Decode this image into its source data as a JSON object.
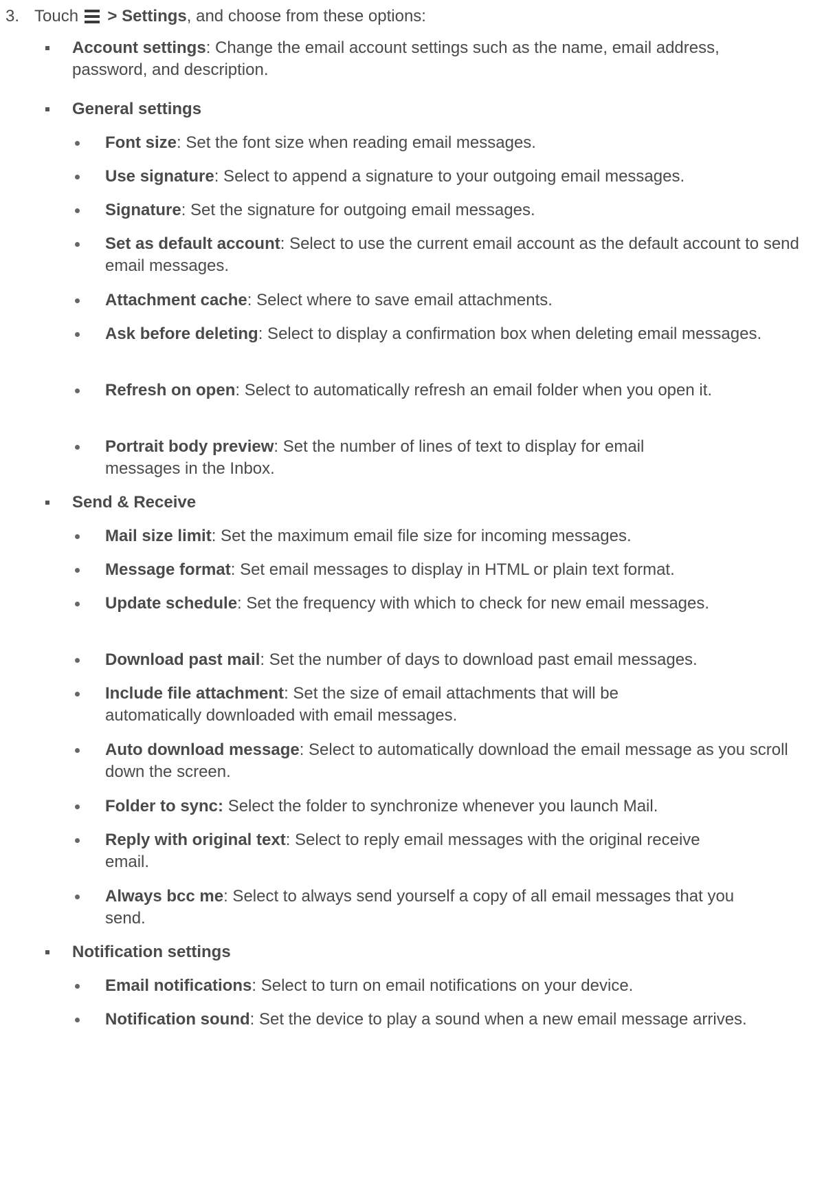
{
  "step": {
    "number": "3.",
    "before": "Touch",
    "menu_icon": "menu-icon",
    "gt": " >",
    "settings": "Settings",
    "after": ", and choose from these options:"
  },
  "account": {
    "title": "Account settings",
    "desc": ": Change the email account settings such as the name, email address, password, and description."
  },
  "general": {
    "title": "General settings",
    "items": [
      {
        "title": "Font size",
        "desc": ": Set the font size when reading email messages."
      },
      {
        "title": "Use signature",
        "desc": ": Select to append a signature to your outgoing email messages."
      },
      {
        "title": "Signature",
        "desc": ": Set the signature for outgoing email messages."
      },
      {
        "title": "Set as default account",
        "desc": ": Select to use the current email account as the default account to send email messages."
      },
      {
        "title": "Attachment cache",
        "desc": ": Select where to save email attachments."
      },
      {
        "title": "Ask before deleting",
        "desc": ": Select to display a confirmation box when deleting email messages."
      },
      {
        "title": "Refresh on open",
        "desc": ": Select to automatically refresh an email folder when you open it."
      },
      {
        "title": "Portrait body preview",
        "desc": ": Set the number of lines of text to display for email messages in the Inbox."
      }
    ]
  },
  "send_receive": {
    "title": "Send & Receive",
    "items": [
      {
        "title": "Mail size limit",
        "desc": ": Set the maximum email file size for incoming messages."
      },
      {
        "title": "Message format",
        "desc": ": Set email messages to display in HTML or plain text format."
      },
      {
        "title": "Update schedule",
        "desc": ": Set the frequency with which to check for new email messages."
      },
      {
        "title": "Download past mail",
        "desc": ": Set the number of days to download past email messages."
      },
      {
        "title": "Include file attachment",
        "desc": ": Set the size of email attachments that will be automatically downloaded with email messages."
      },
      {
        "title": "Auto download message",
        "desc": ": Select to automatically download the email message as you scroll down the screen."
      },
      {
        "title": "Folder to sync:",
        "desc": " Select the folder to synchronize whenever you launch Mail."
      },
      {
        "title": "Reply with original text",
        "desc": ": Select to reply email messages with the original receive email."
      },
      {
        "title": "Always bcc me",
        "desc": ": Select to always send yourself a copy of all email messages that you send."
      }
    ]
  },
  "notification": {
    "title": "Notification settings",
    "items": [
      {
        "title": "Email notifications",
        "desc": ": Select to turn on email notifications on your device."
      },
      {
        "title": "Notification sound",
        "desc": ": Set the device to play a sound when a new email message arrives."
      }
    ]
  }
}
